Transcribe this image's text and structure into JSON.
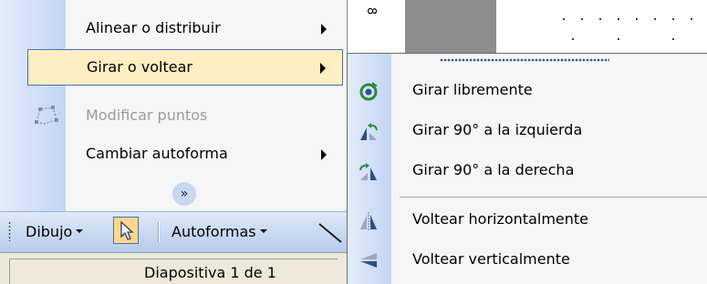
{
  "left_menu": {
    "items": [
      {
        "label": "Alinear o distribuir",
        "has_submenu": true,
        "state": "normal"
      },
      {
        "label": "Girar o voltear",
        "has_submenu": true,
        "state": "highlighted"
      },
      {
        "label": "Modificar puntos",
        "has_submenu": false,
        "state": "disabled"
      },
      {
        "label": "Cambiar autoforma",
        "has_submenu": true,
        "state": "normal"
      }
    ],
    "expand_icon": "double-chevron-down-icon"
  },
  "submenu": {
    "title_ref": "Girar o voltear",
    "items": [
      {
        "label": "Girar libremente",
        "icon": "free-rotate-icon"
      },
      {
        "label": "Girar 90° a la izquierda",
        "icon": "rotate-left-icon"
      },
      {
        "label": "Girar 90° a la derecha",
        "icon": "rotate-right-icon"
      },
      {
        "label": "Voltear horizontalmente",
        "icon": "flip-horizontal-icon"
      },
      {
        "label": "Voltear verticalmente",
        "icon": "flip-vertical-icon"
      }
    ]
  },
  "toolbar": {
    "dibujo_label": "Dibujo",
    "autoformas_label": "Autoformas",
    "select_tool_icon": "cursor-arrow-icon",
    "line_tool_icon": "line-tool-icon"
  },
  "statusbar": {
    "text": "Diapositiva 1 de 1"
  },
  "ruler": {
    "mark": "8"
  },
  "colors": {
    "menu_bg": "#f6f6f6",
    "highlight_bg": "#ffeec2",
    "highlight_border": "#4a6fb5",
    "gutter": "#c3d5f3",
    "disabled_text": "#9b9b9b"
  }
}
